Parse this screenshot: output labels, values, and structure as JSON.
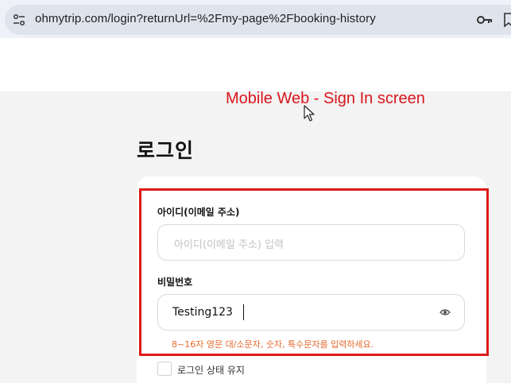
{
  "browser": {
    "url": "ohmytrip.com/login?returnUrl=%2Fmy-page%2Fbooking-history",
    "icons": [
      "site-info-icon",
      "key-icon"
    ]
  },
  "annotation": "Mobile Web - Sign In screen",
  "page": {
    "title": "로그인"
  },
  "login_form": {
    "id_label": "아이디(이메일 주소)",
    "id_placeholder": "아이디(이메일 주소) 입력",
    "id_value": "",
    "password_label": "비밀번호",
    "password_value": "Testing123",
    "password_hint": "8~16자 영문 대/소문자, 숫자, 특수문자를 입력하세요.",
    "keep_signed_in_label": "로그인 상태 유지",
    "keep_signed_in_checked": false
  },
  "colors": {
    "annotation": "#d8161b",
    "highlight_border": "#dd1a1a",
    "hint": "#e56a2e"
  }
}
